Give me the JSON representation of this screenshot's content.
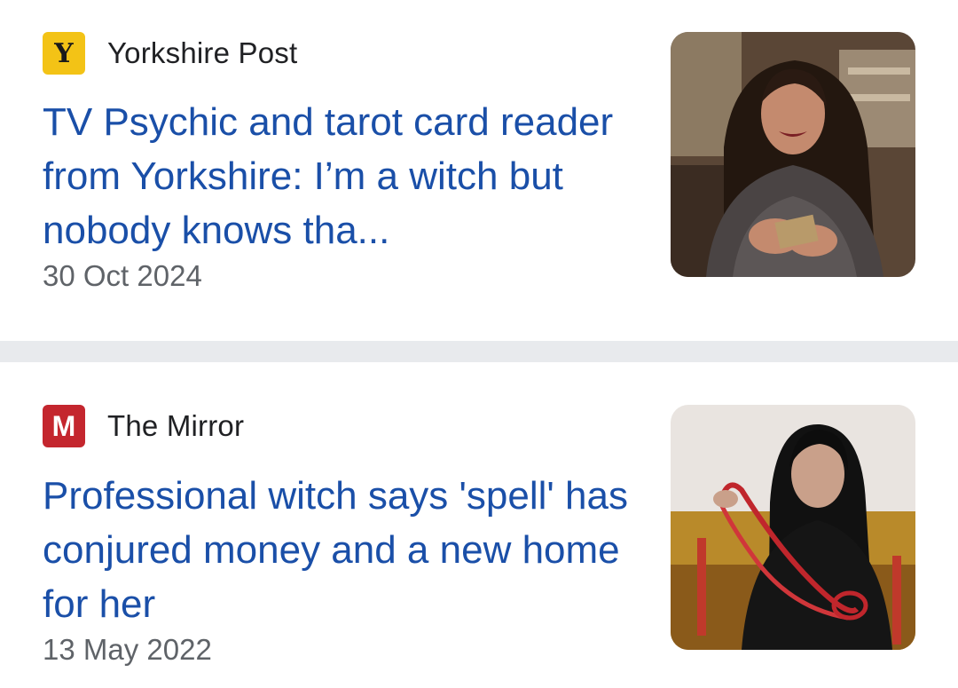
{
  "articles": [
    {
      "source": "Yorkshire Post",
      "logo_letter": "Y",
      "logo_color": "#f3c316",
      "headline": "TV Psychic and tarot card reader from Yorkshire: I’m a witch but nobody knows tha...",
      "date": "30 Oct 2024",
      "thumbnail": "smiling-woman-with-tarot-cards"
    },
    {
      "source": "The Mirror",
      "logo_letter": "M",
      "logo_color": "#c4262e",
      "headline": "Professional witch says 'spell' has conjured money and a new home for her",
      "date": "13 May 2022",
      "thumbnail": "woman-with-red-cord-and-candles"
    }
  ],
  "colors": {
    "headline": "#1a4fa8",
    "divider": "#e8eaed",
    "date": "#5f6368"
  }
}
